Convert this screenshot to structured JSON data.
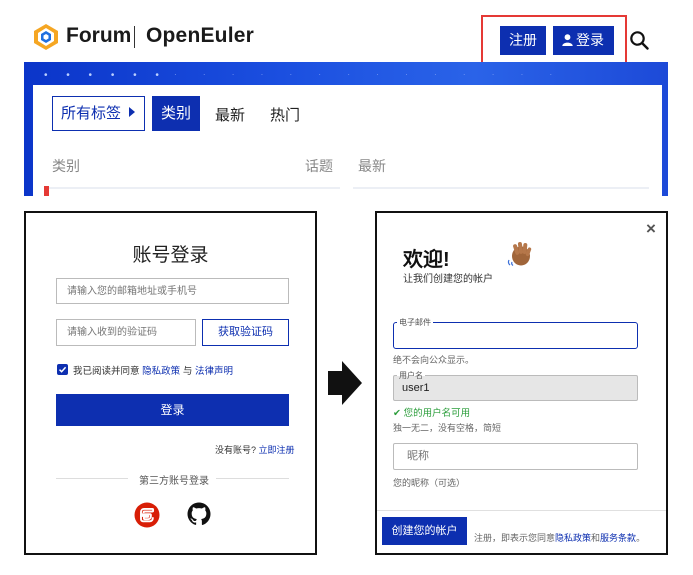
{
  "header": {
    "logo_forum": "Forum",
    "logo_brand": "OpenEuler",
    "register_label": "注册",
    "login_label": "登录",
    "accent_color": "#0d2fb0",
    "highlight_color": "#e53935"
  },
  "forum": {
    "all_tags_label": "所有标签",
    "tabs": [
      {
        "label": "类别",
        "active": true
      },
      {
        "label": "最新",
        "active": false
      },
      {
        "label": "热门",
        "active": false
      }
    ],
    "columns": {
      "category": "类别",
      "topics": "话题",
      "latest": "最新"
    }
  },
  "login": {
    "title": "账号登录",
    "email_placeholder": "请输入您的邮箱地址或手机号",
    "code_placeholder": "请输入收到的验证码",
    "get_code_label": "获取验证码",
    "agree_prefix": "我已阅读并同意",
    "privacy_link": "隐私政策",
    "and_text": "与",
    "legal_link": "法律声明",
    "agree_checked": true,
    "submit_label": "登录",
    "no_account_text": "没有账号?",
    "register_link": "立即注册",
    "third_party_label": "第三方账号登录",
    "third_party_icons": [
      "gitee-icon",
      "github-icon"
    ]
  },
  "signup": {
    "welcome_title": "欢迎!",
    "welcome_subtitle": "让我们创建您的帐户",
    "email_legend": "电子邮件",
    "email_help": "绝不会向公众显示。",
    "username_legend": "用户名",
    "username_value": "user1",
    "username_ok": "您的用户名可用",
    "username_help": "独一无二，没有空格，简短",
    "nickname_placeholder": "昵称",
    "nickname_help": "您的昵称（可选）",
    "create_label": "创建您的帐户",
    "terms_prefix": "注册，即表示您同意",
    "terms_privacy": "隐私政策",
    "terms_and": "和",
    "terms_service": "服务条款",
    "terms_suffix": "。",
    "close_icon": "×"
  }
}
